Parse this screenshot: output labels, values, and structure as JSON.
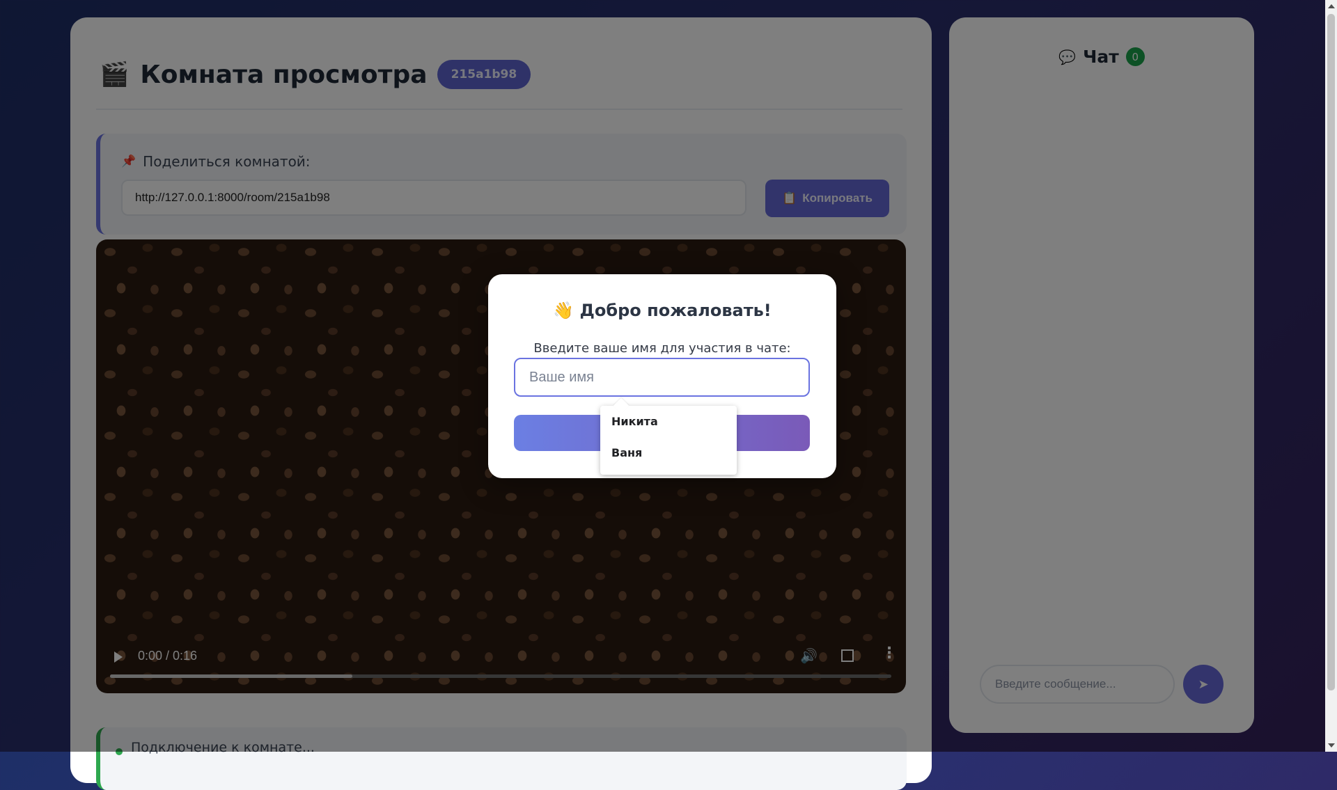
{
  "room": {
    "icon": "clapperboard-icon",
    "title": "Комната просмотра",
    "id_badge": "215a1b98"
  },
  "share": {
    "icon": "pushpin-icon",
    "label": "Поделиться комнатой:",
    "url": "http://127.0.0.1:8000/room/215a1b98",
    "copy_icon": "clipboard-icon",
    "copy_label": "Копировать"
  },
  "video": {
    "time": "0:00 / 0:16",
    "progress": 0.31
  },
  "status": {
    "text": "Подключение к комнате..."
  },
  "chat": {
    "icon": "speech-bubble-icon",
    "title": "Чат",
    "count": "0",
    "input_placeholder": "Введите сообщение...",
    "send_icon": "➤"
  },
  "modal": {
    "title": "👋 Добро пожаловать!",
    "hint": "Введите ваше имя для участия в чате:",
    "name_placeholder": "Ваше имя"
  },
  "autocomplete": {
    "items": [
      "Никита",
      "Ваня"
    ]
  },
  "colors": {
    "accent": "#667eea",
    "accent2": "#764ba2",
    "success": "#1aa34a"
  }
}
